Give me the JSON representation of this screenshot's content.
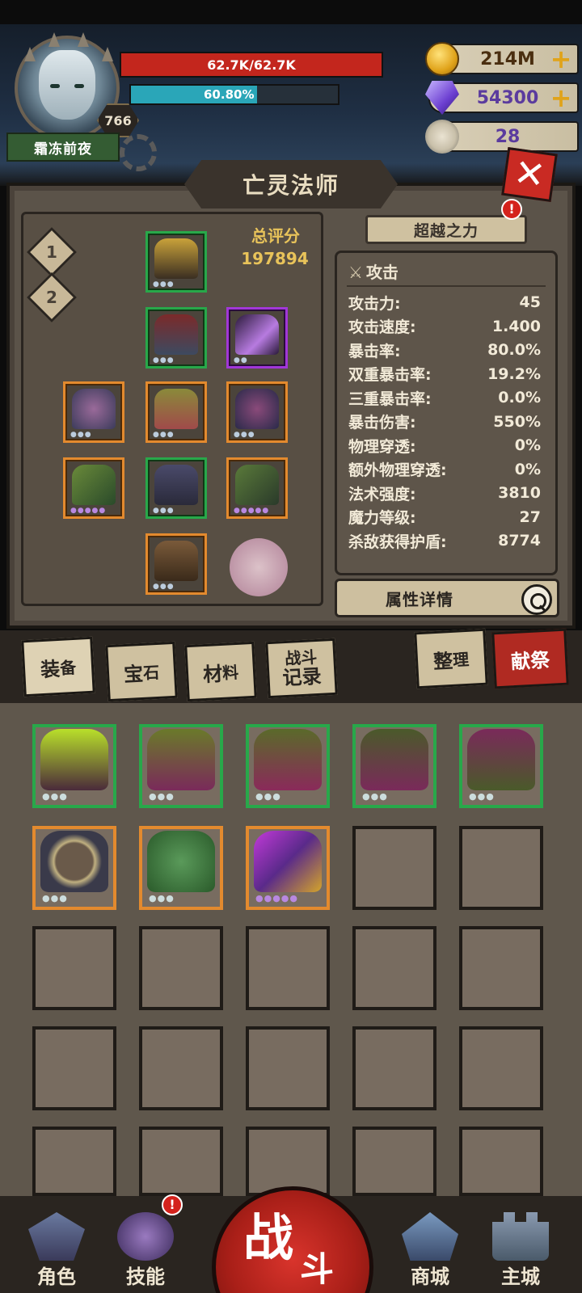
{
  "player": {
    "name": "霜冻前夜",
    "level": "766",
    "hp_text": "62.7K/62.7K",
    "hp_fraction": 1.0,
    "mp_text": "60.80%",
    "mp_fraction": 0.608
  },
  "resources": {
    "gold": "214M",
    "gems": "54300",
    "skulls": "28",
    "plus": "+"
  },
  "panel": {
    "title": "亡灵法师",
    "close": "✕",
    "slot_tab_1": "1",
    "slot_tab_2": "2",
    "score_label": "总评分",
    "score_value": "197894",
    "transcend_label": "超越之力",
    "transcend_badge": "!",
    "stats_header": "攻击",
    "stats": [
      {
        "label": "攻击力:",
        "value": "45"
      },
      {
        "label": "攻击速度:",
        "value": "1.400"
      },
      {
        "label": "暴击率:",
        "value": "80.0%"
      },
      {
        "label": "双重暴击率:",
        "value": "19.2%"
      },
      {
        "label": "三重暴击率:",
        "value": "0.0%"
      },
      {
        "label": "暴击伤害:",
        "value": "550%"
      },
      {
        "label": "物理穿透:",
        "value": "0%"
      },
      {
        "label": "额外物理穿透:",
        "value": "0%"
      },
      {
        "label": "法术强度:",
        "value": "3810"
      },
      {
        "label": "魔力等级:",
        "value": "27"
      },
      {
        "label": "杀敌获得护盾:",
        "value": "8774"
      }
    ],
    "detail_button": "属性详情"
  },
  "tabs": {
    "equipment_a": "装",
    "equipment_b": "备",
    "gems_a": "宝",
    "gems_b": "石",
    "materials_a": "材",
    "materials_b": "料",
    "battle_log_a": "战斗",
    "battle_log_b": "记录",
    "sort_a": "整",
    "sort_b": "理",
    "sacrifice": "献祭"
  },
  "bottom_nav": {
    "character": "角色",
    "skills": "技能",
    "skills_badge": "!",
    "battle_a": "战",
    "battle_b": "斗",
    "shop": "商城",
    "main_city": "主城"
  },
  "colors": {
    "hp": "#c3261d",
    "mp": "#2aa6b8",
    "rarity_green": "#28a84a",
    "rarity_orange": "#e38a2e",
    "rarity_purple": "#a137d8",
    "score_gold": "#e8c35a"
  }
}
